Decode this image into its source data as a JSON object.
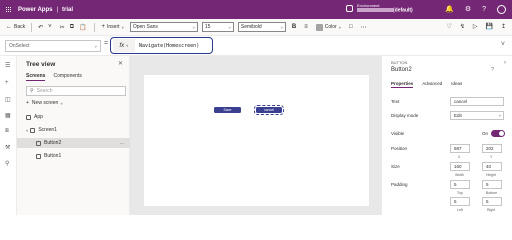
{
  "header": {
    "app_name": "Power Apps",
    "separator": "|",
    "app_title": "trial",
    "environment_label": "Environment",
    "environment_name": "(default)",
    "icons": [
      "bell-icon",
      "gear-icon",
      "help-icon",
      "avatar"
    ]
  },
  "command_bar": {
    "back": "Back",
    "insert": "Insert",
    "font": "Open Sans",
    "font_size": "15",
    "font_weight": "Semibold",
    "color": "Color",
    "icons": [
      "undo-icon",
      "redo-icon",
      "cut-icon",
      "copy-icon",
      "paste-icon",
      "insert-icon",
      "plus-icon",
      "align-icon",
      "more-icon"
    ]
  },
  "formula_bar": {
    "property": "OnSelect",
    "equals": "=",
    "fx": "fx",
    "formula": "Navigate(Homescreen)"
  },
  "tree_view": {
    "title": "Tree view",
    "tabs": [
      "Screens",
      "Components"
    ],
    "search_placeholder": "Search",
    "new_screen": "New screen",
    "items": [
      {
        "label": "App"
      },
      {
        "label": "Screen1"
      },
      {
        "label": "Button2"
      },
      {
        "label": "Button1"
      }
    ],
    "more": "..."
  },
  "canvas": {
    "save_button": "Save",
    "cancel_button": "cancel"
  },
  "properties": {
    "type": "BUTTON",
    "name": "Button2",
    "tabs": [
      "Properties",
      "Advanced",
      "Ideas"
    ],
    "text_label": "Text",
    "text_value": "cancel",
    "display_mode_label": "Display mode",
    "display_mode_value": "Edit",
    "visible_label": "Visible",
    "visible_value": "On",
    "visible_on": true,
    "position_label": "Position",
    "position_x": "687",
    "position_y": "202",
    "pos_x_sub": "X",
    "pos_y_sub": "Y",
    "size_label": "Size",
    "size_w": "160",
    "size_h": "40",
    "width_sub": "Width",
    "height_sub": "Height",
    "padding_label": "Padding",
    "pad_top": "5",
    "pad_bottom": "5",
    "pad_left": "5",
    "pad_right": "5",
    "top_sub": "Top",
    "bottom_sub": "Bottom",
    "left_sub": "Left",
    "right_sub": "Right"
  },
  "colors": {
    "brand": "#742774",
    "formula_highlight": "#2b3990",
    "button_fill": "#3a3f8f"
  }
}
